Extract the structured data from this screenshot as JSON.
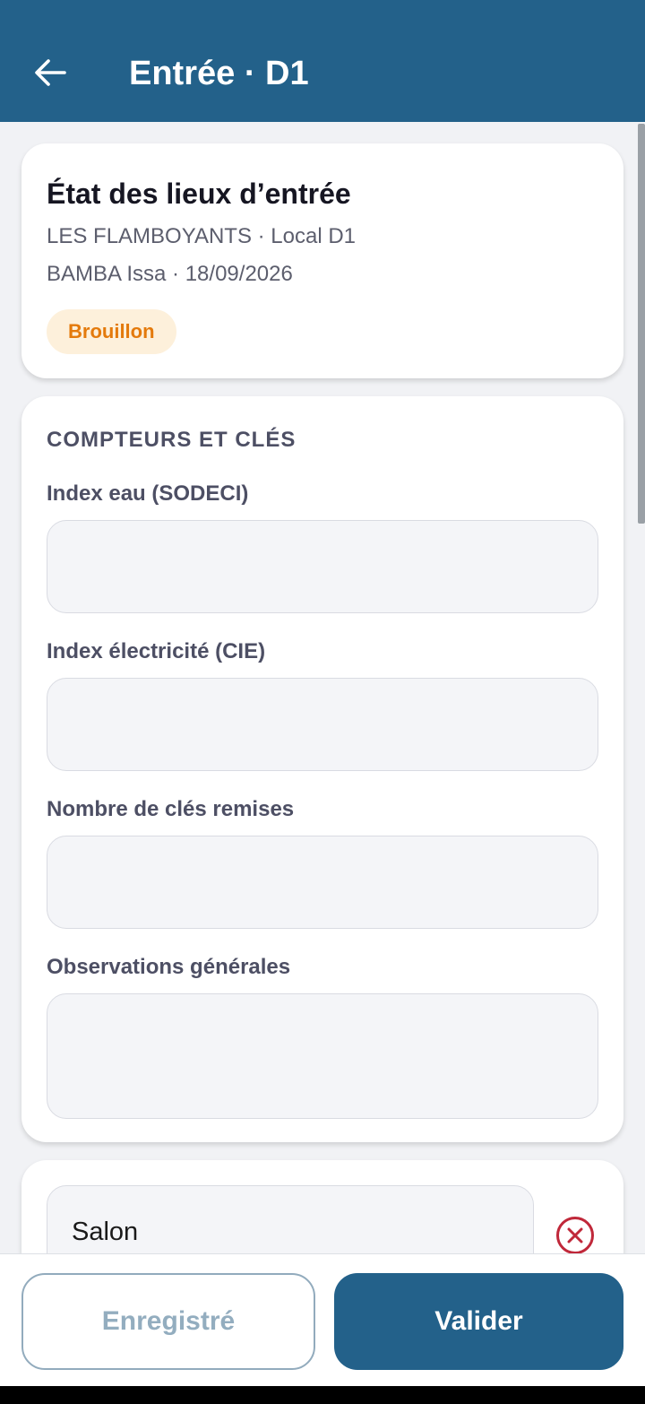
{
  "appbar": {
    "title": "Entrée · D1"
  },
  "header_card": {
    "title": "État des lieux d’entrée",
    "property_line": "LES FLAMBOYANTS · Local D1",
    "tenant_line": "BAMBA Issa · 18/09/2026",
    "status": "Brouillon"
  },
  "form": {
    "section_title": "COMPTEURS ET CLÉS",
    "water_label": "Index eau (SODECI)",
    "water_value": "",
    "electricity_label": "Index électricité (CIE)",
    "electricity_value": "",
    "keys_label": "Nombre de clés remises",
    "keys_value": "",
    "observations_label": "Observations générales",
    "observations_value": ""
  },
  "room": {
    "name": "Salon"
  },
  "actions": {
    "saved_label": "Enregistré",
    "validate_label": "Valider"
  },
  "colors": {
    "primary": "#23618a",
    "badge_bg": "#fdf0db",
    "badge_text": "#e47a0c",
    "danger": "#c0283a"
  }
}
